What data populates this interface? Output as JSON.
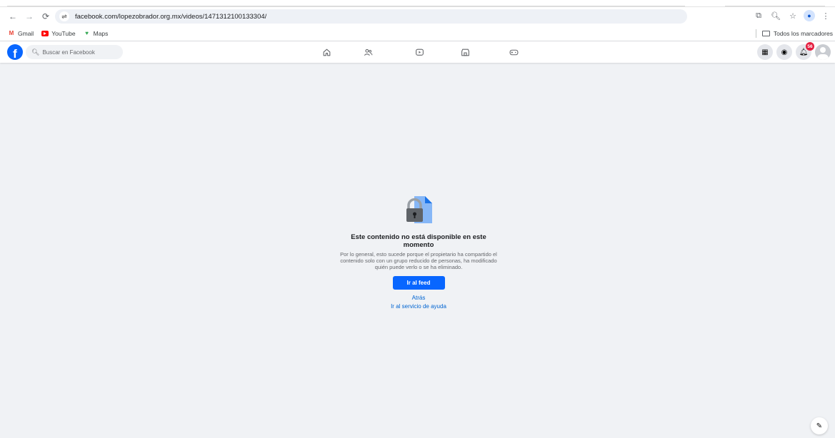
{
  "browser": {
    "url": "facebook.com/lopezobrador.org.mx/videos/1471312100133304/",
    "bookmarks": [
      {
        "label": "Gmail",
        "icon": "gmail-icon"
      },
      {
        "label": "YouTube",
        "icon": "youtube-icon"
      },
      {
        "label": "Maps",
        "icon": "maps-icon"
      }
    ],
    "all_bookmarks_label": "Todos los marcadores"
  },
  "facebook": {
    "search_placeholder": "Buscar en Facebook",
    "nav_icons": [
      "home-icon",
      "friends-icon",
      "watch-icon",
      "marketplace-icon",
      "gaming-icon"
    ],
    "notification_count": "56",
    "brand_color": "#0866ff"
  },
  "content": {
    "heading": "Este contenido no está disponible en este momento",
    "description": "Por lo general, esto sucede porque el propietario ha compartido el contenido solo con un grupo reducido de personas, ha modificado quién puede verlo o se ha eliminado.",
    "primary_button": "Ir al feed",
    "back_link": "Atrás",
    "help_link": "Ir al servicio de ayuda"
  }
}
